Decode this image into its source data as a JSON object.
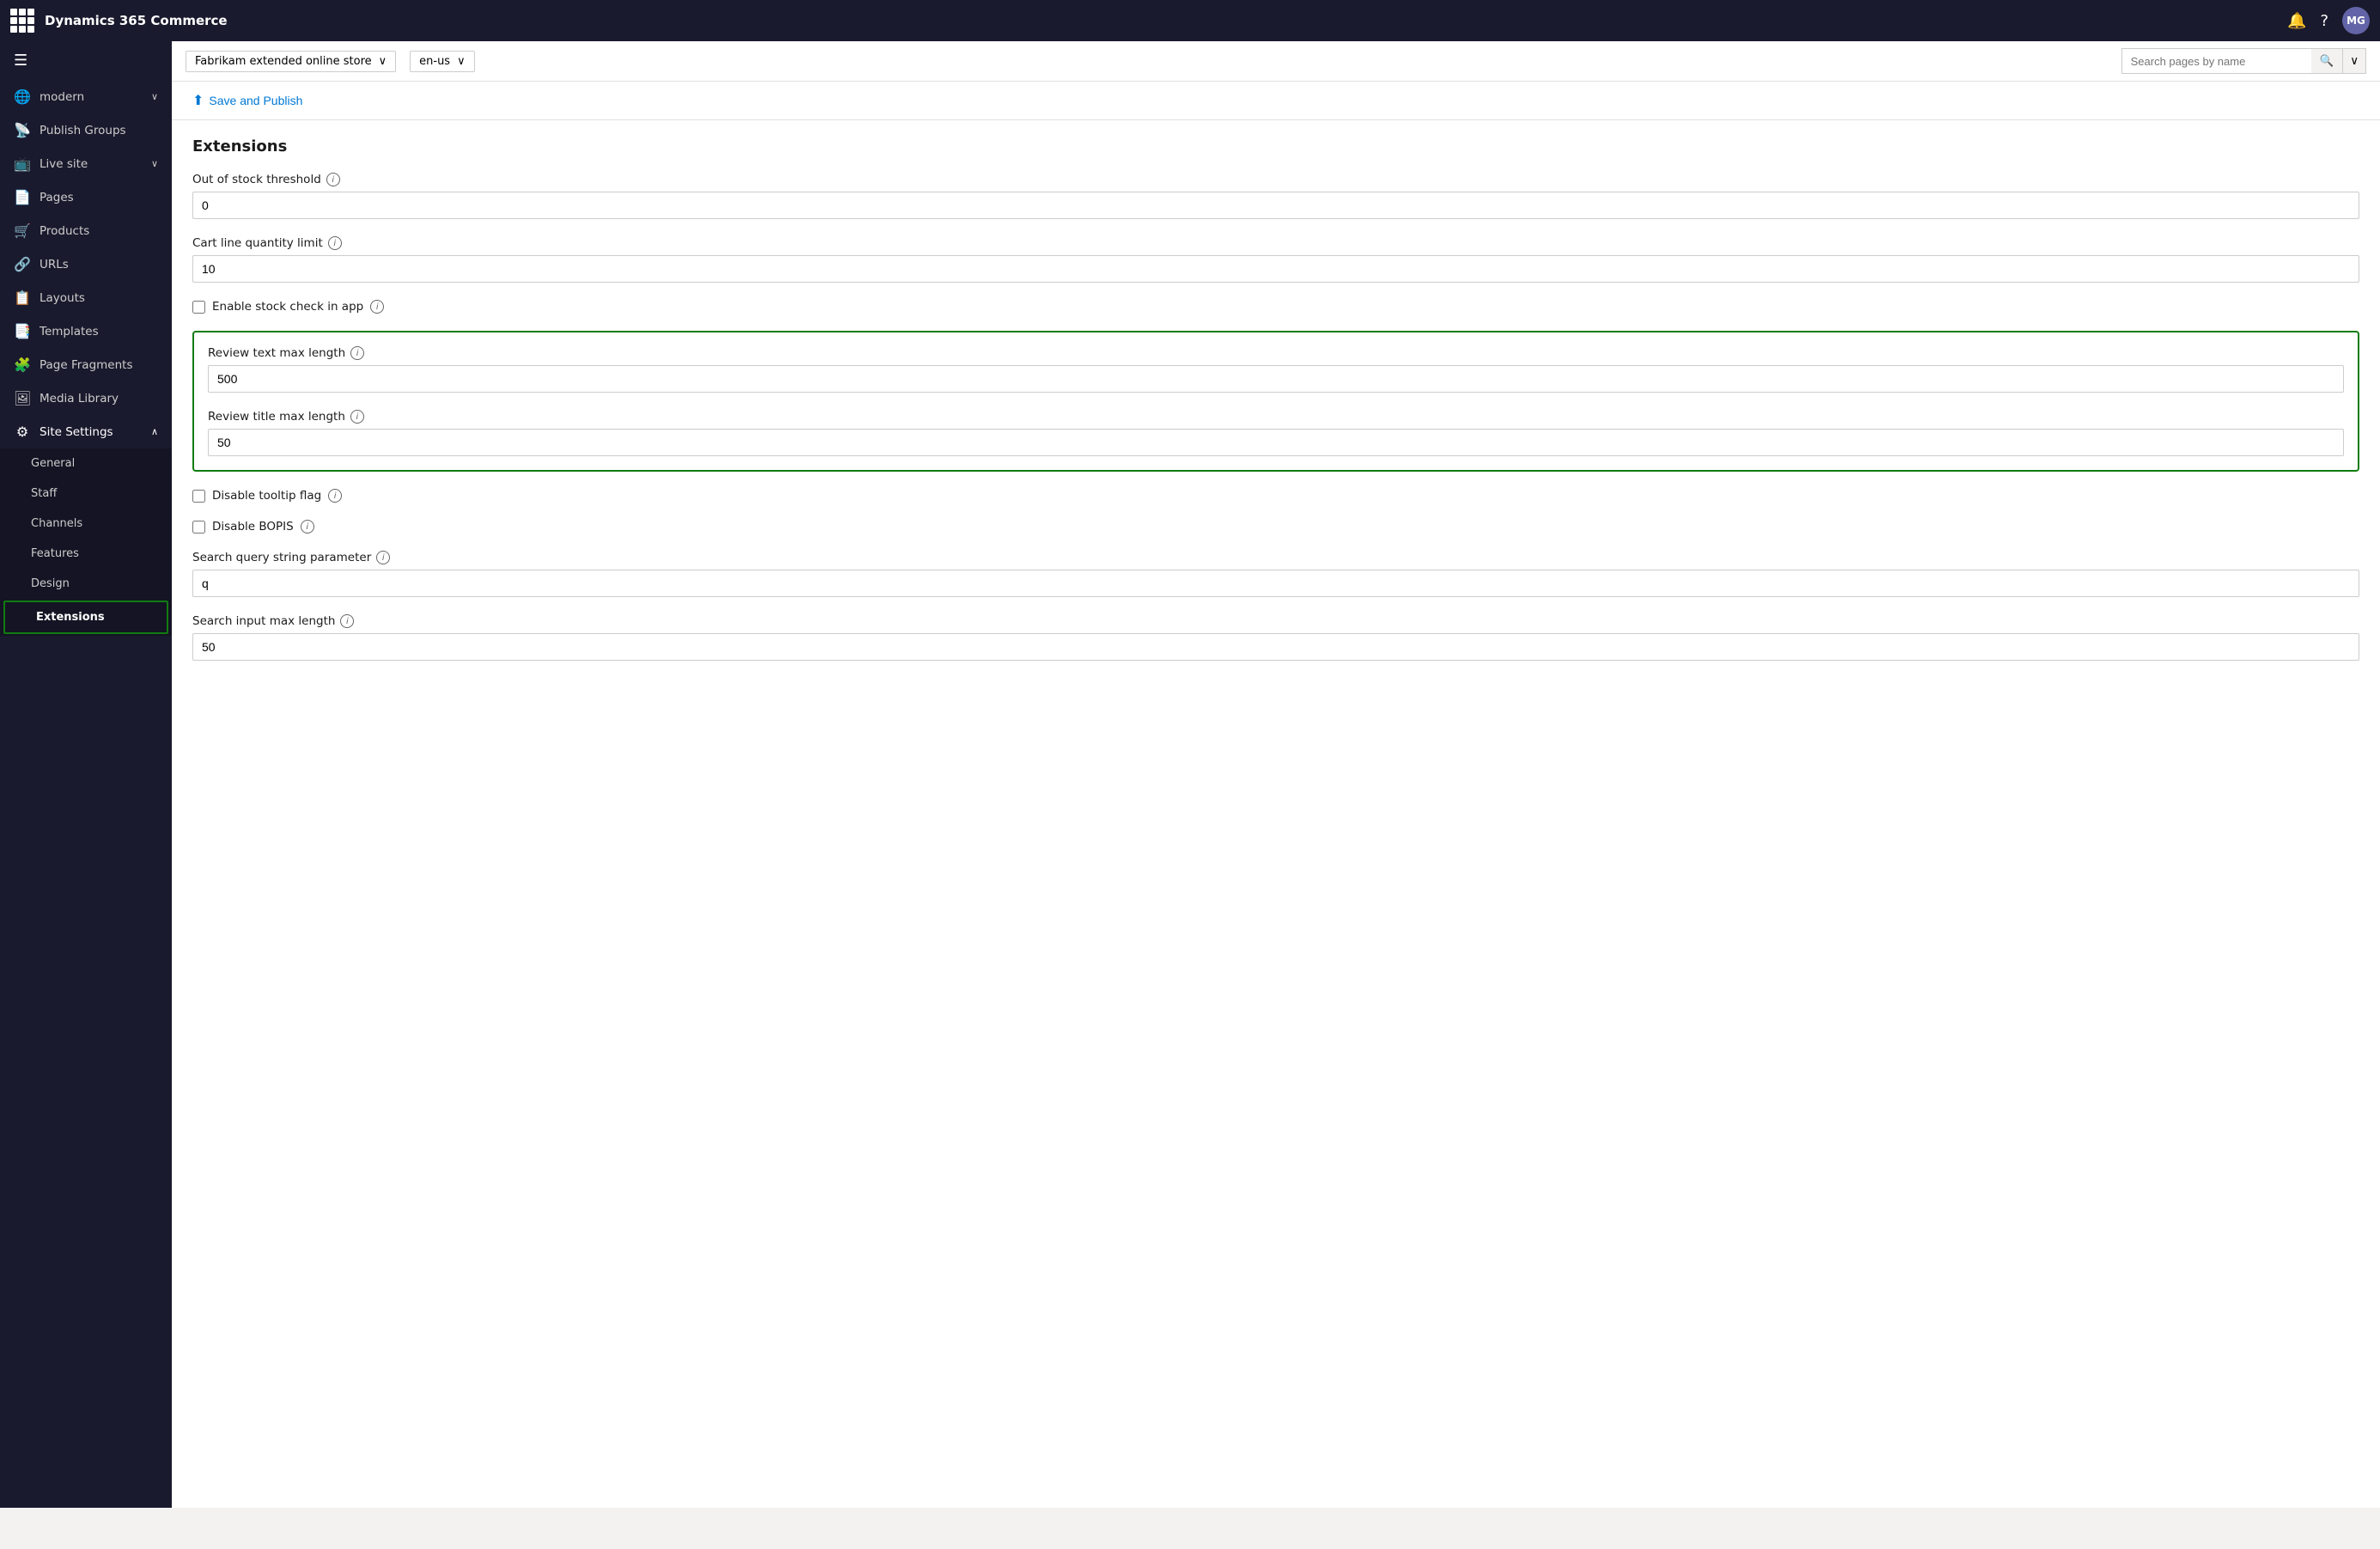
{
  "app": {
    "title": "Dynamics 365 Commerce",
    "avatar": "MG"
  },
  "topbar": {
    "bell_icon": "🔔",
    "help_icon": "?",
    "waffle_icon": "⋮⋮⋮"
  },
  "subheader": {
    "store_label": "Fabrikam extended online store",
    "locale_label": "en-us",
    "search_placeholder": "Search pages by name"
  },
  "toolbar": {
    "save_publish_label": "Save and Publish"
  },
  "sidebar": {
    "collapse_icon": "☰",
    "items": [
      {
        "id": "modern",
        "label": "modern",
        "icon": "🌐",
        "has_chevron": true,
        "active": false
      },
      {
        "id": "publish-groups",
        "label": "Publish Groups",
        "icon": "📡",
        "has_chevron": false,
        "active": false
      },
      {
        "id": "live-site",
        "label": "Live site",
        "icon": "🔴",
        "has_chevron": true,
        "active": false
      },
      {
        "id": "pages",
        "label": "Pages",
        "icon": "📄",
        "has_chevron": false,
        "active": false
      },
      {
        "id": "products",
        "label": "Products",
        "icon": "🛒",
        "has_chevron": false,
        "active": false
      },
      {
        "id": "urls",
        "label": "URLs",
        "icon": "🔗",
        "has_chevron": false,
        "active": false
      },
      {
        "id": "layouts",
        "label": "Layouts",
        "icon": "📋",
        "has_chevron": false,
        "active": false
      },
      {
        "id": "templates",
        "label": "Templates",
        "icon": "📑",
        "has_chevron": false,
        "active": false
      },
      {
        "id": "page-fragments",
        "label": "Page Fragments",
        "icon": "🧩",
        "has_chevron": false,
        "active": false
      },
      {
        "id": "media-library",
        "label": "Media Library",
        "icon": "🖼",
        "has_chevron": false,
        "active": false
      },
      {
        "id": "site-settings",
        "label": "Site Settings",
        "icon": "⚙",
        "has_chevron": true,
        "active": true
      }
    ],
    "submenu": [
      {
        "id": "general",
        "label": "General",
        "active": false
      },
      {
        "id": "staff",
        "label": "Staff",
        "active": false
      },
      {
        "id": "channels",
        "label": "Channels",
        "active": false
      },
      {
        "id": "features",
        "label": "Features",
        "active": false
      },
      {
        "id": "design",
        "label": "Design",
        "active": false
      },
      {
        "id": "extensions",
        "label": "Extensions",
        "active": true
      }
    ]
  },
  "content": {
    "page_title": "Extensions",
    "fields": [
      {
        "id": "out-of-stock-threshold",
        "label": "Out of stock threshold",
        "type": "input",
        "value": "0",
        "has_info": true,
        "highlighted": false
      },
      {
        "id": "cart-line-quantity-limit",
        "label": "Cart line quantity limit",
        "type": "input",
        "value": "10",
        "has_info": true,
        "highlighted": false
      },
      {
        "id": "enable-stock-check",
        "label": "Enable stock check in app",
        "type": "checkbox",
        "checked": false,
        "has_info": true,
        "highlighted": false
      },
      {
        "id": "review-text-max-length",
        "label": "Review text max length",
        "type": "input",
        "value": "500",
        "has_info": true,
        "highlighted": true
      },
      {
        "id": "review-title-max-length",
        "label": "Review title max length",
        "type": "input",
        "value": "50",
        "has_info": true,
        "highlighted": true
      },
      {
        "id": "disable-tooltip-flag",
        "label": "Disable tooltip flag",
        "type": "checkbox",
        "checked": false,
        "has_info": true,
        "highlighted": false
      },
      {
        "id": "disable-bopis",
        "label": "Disable BOPIS",
        "type": "checkbox",
        "checked": false,
        "has_info": true,
        "highlighted": false
      },
      {
        "id": "search-query-string-parameter",
        "label": "Search query string parameter",
        "type": "input",
        "value": "q",
        "has_info": true,
        "highlighted": false
      },
      {
        "id": "search-input-max-length",
        "label": "Search input max length",
        "type": "input",
        "value": "50",
        "has_info": true,
        "highlighted": false
      }
    ]
  }
}
